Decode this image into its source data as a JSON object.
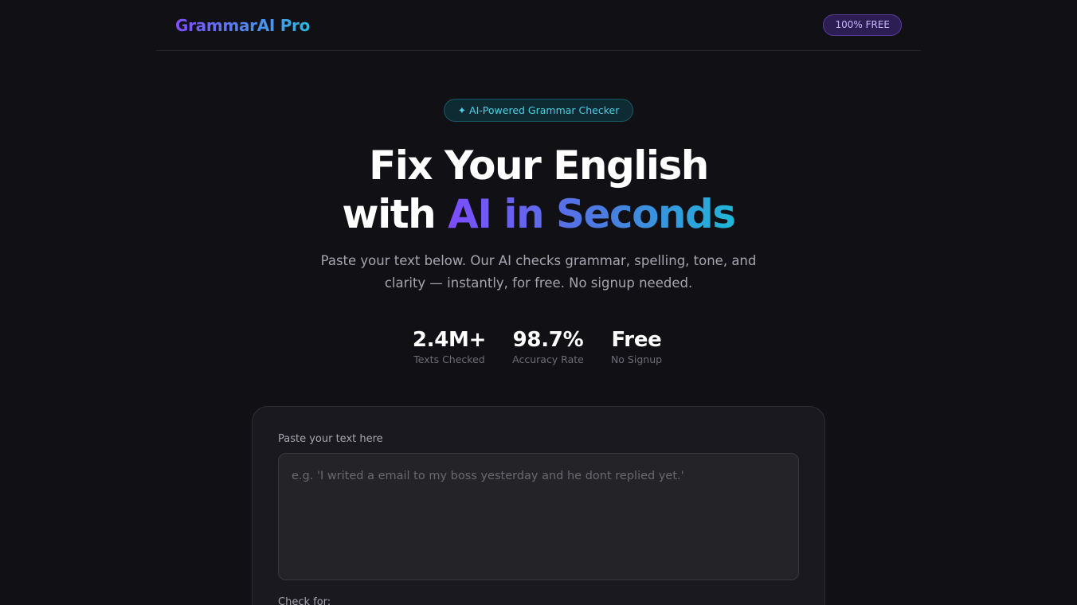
{
  "header": {
    "logo": "GrammarAI Pro",
    "badge": "100% FREE"
  },
  "hero": {
    "pill_icon": "sparkle-icon",
    "pill_text": "✦ AI-Powered Grammar Checker",
    "title_line1": "Fix Your English",
    "title_line2_prefix": "with ",
    "title_line2_highlight": "AI in Seconds",
    "subtitle": "Paste your text below. Our AI checks grammar, spelling, tone, and clarity — instantly, for free. No signup needed."
  },
  "stats": [
    {
      "value": "2.4M+",
      "label": "Texts Checked"
    },
    {
      "value": "98.7%",
      "label": "Accuracy Rate"
    },
    {
      "value": "Free",
      "label": "No Signup"
    }
  ],
  "card": {
    "input_label": "Paste your text here",
    "input_value": "",
    "input_placeholder": "e.g. 'I writed a email to my boss yesterday and he dont replied yet.'",
    "check_for_label": "Check for:"
  },
  "colors": {
    "background": "#111015",
    "accent_purple": "#7c4dff",
    "accent_cyan": "#1fb6d8",
    "card": "#1a191f"
  }
}
